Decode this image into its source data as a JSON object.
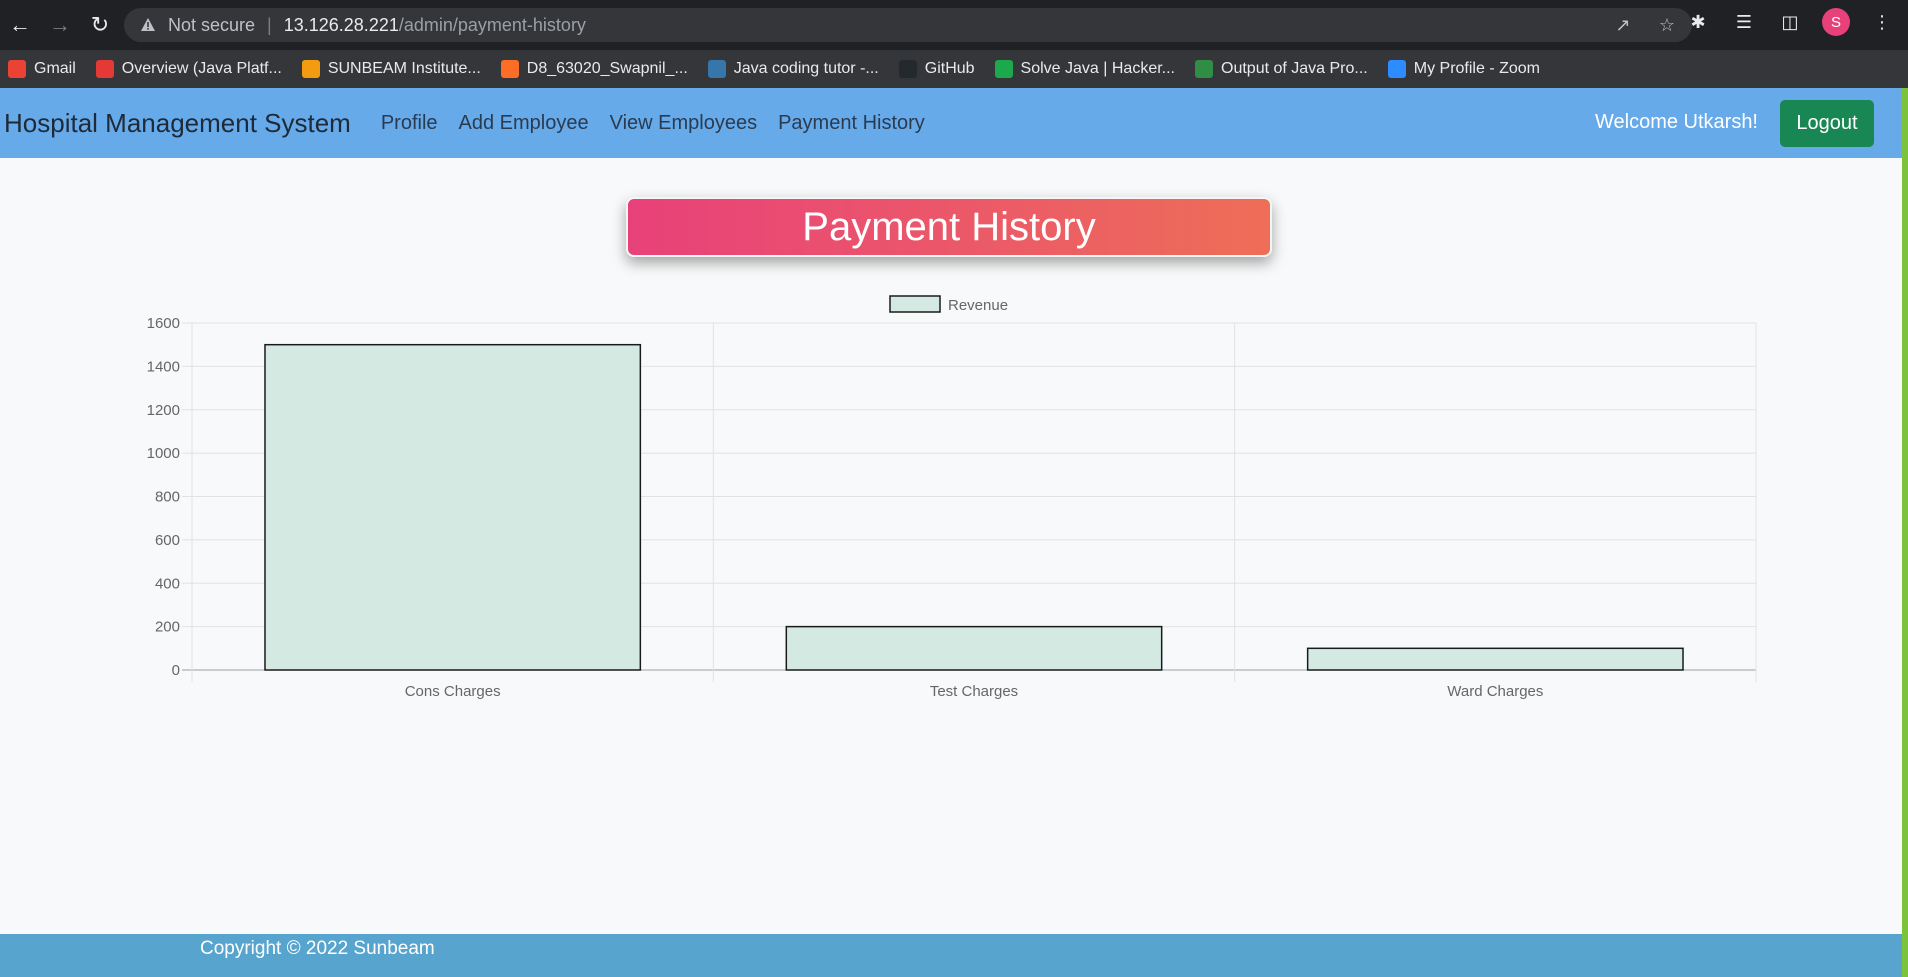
{
  "browser": {
    "security_label": "Not secure",
    "url_host": "13.126.28.221",
    "url_path": "/admin/payment-history",
    "profile_initial": "S"
  },
  "bookmarks": [
    {
      "label": "Gmail",
      "color": "#ea4335"
    },
    {
      "label": "Overview (Java Platf...",
      "color": "#e53935"
    },
    {
      "label": "SUNBEAM Institute...",
      "color": "#f39c12"
    },
    {
      "label": "D8_63020_Swapnil_...",
      "color": "#fc6d26"
    },
    {
      "label": "Java coding tutor -...",
      "color": "#3776ab"
    },
    {
      "label": "GitHub",
      "color": "#24292e"
    },
    {
      "label": "Solve Java | Hacker...",
      "color": "#1ba94c"
    },
    {
      "label": "Output of Java Pro...",
      "color": "#2f8d46"
    },
    {
      "label": "My Profile - Zoom",
      "color": "#2d8cff"
    }
  ],
  "navbar": {
    "brand": "Hospital Management System",
    "links": [
      "Profile",
      "Add Employee",
      "View Employees",
      "Payment History"
    ],
    "welcome": "Welcome Utkarsh!",
    "logout": "Logout"
  },
  "page": {
    "heading": "Payment History",
    "footer": "Copyright © 2022 Sunbeam"
  },
  "chart_data": {
    "type": "bar",
    "categories": [
      "Cons Charges",
      "Test Charges",
      "Ward Charges"
    ],
    "series": [
      {
        "name": "Revenue",
        "values": [
          1500,
          200,
          100
        ]
      }
    ],
    "ylim": [
      0,
      1600
    ],
    "yticks": [
      0,
      200,
      400,
      600,
      800,
      1000,
      1200,
      1400,
      1600
    ],
    "legend_position": "top-center",
    "grid": true,
    "bar_fill": "#d3e9e2",
    "bar_stroke": "#1a1a1a"
  }
}
